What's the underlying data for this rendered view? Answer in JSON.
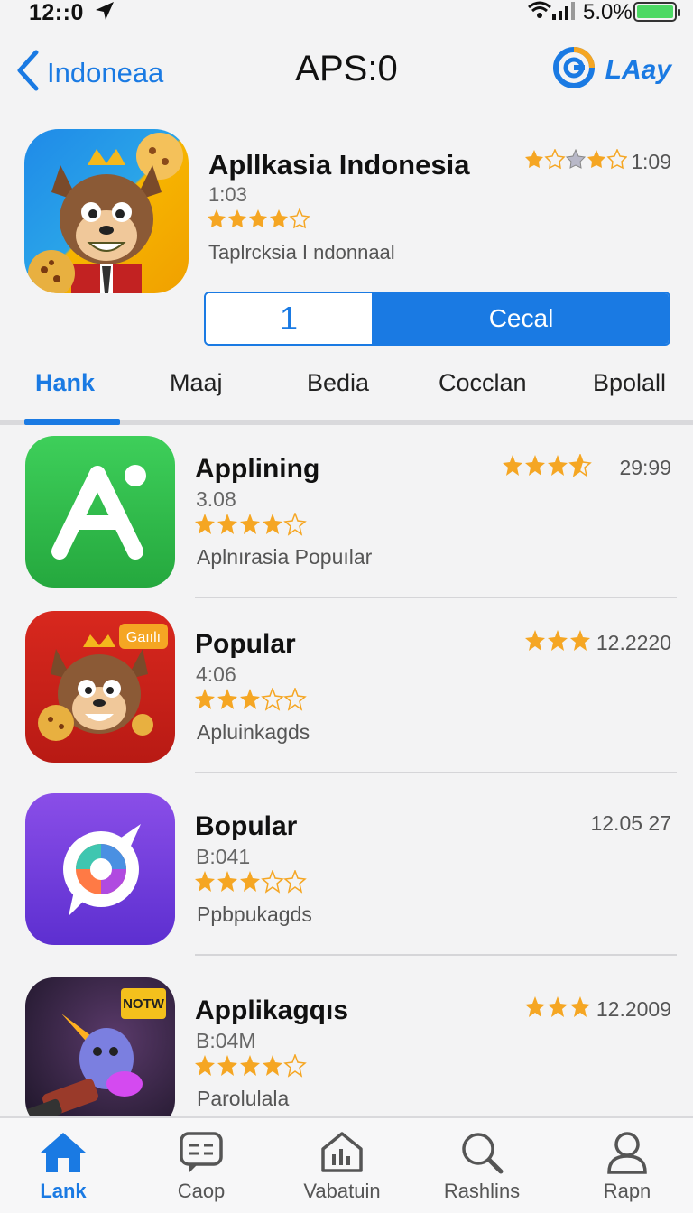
{
  "status_bar": {
    "time": "12::0",
    "battery_text": "5.0%",
    "battery_color": "#4cd964"
  },
  "nav": {
    "back_label": "Indoneaa",
    "title": "APS:0",
    "brand_label": "LAay",
    "accent_color": "#1a7ae3"
  },
  "featured": {
    "title": "Apllkasia Indonesia",
    "subtitle": "1:03",
    "rating_stars": 4,
    "description": "Taplrcksia I ndonnaal",
    "meta": "1:09",
    "meta_stars": 4,
    "segment_left": "1",
    "segment_right": "Cecal"
  },
  "tabs": [
    {
      "label": "Hank",
      "active": true
    },
    {
      "label": "Maaj",
      "active": false
    },
    {
      "label": "Bedia",
      "active": false
    },
    {
      "label": "Cocclan",
      "active": false
    },
    {
      "label": "Bpolall",
      "active": false
    }
  ],
  "apps": [
    {
      "name": "Applining",
      "size": "3.08",
      "stars": 4,
      "description": "Aplnırasia Popuılar",
      "meta": "29:99",
      "meta_stars": 3.5,
      "icon": "letter-a-icon"
    },
    {
      "name": "Popular",
      "size": "4:06",
      "stars": 3,
      "description": "Apluinkagds",
      "meta": "12.2220",
      "meta_stars": 3,
      "icon": "mascot-icon",
      "badge": "Gaıılı"
    },
    {
      "name": "Bopular",
      "size": "B:041",
      "stars": 3,
      "description": "Ppbpukagds",
      "meta": "12.05 27",
      "meta_stars": 0,
      "icon": "compass-icon"
    },
    {
      "name": "Applikagqıs",
      "size": "B:04M",
      "stars": 4,
      "description": "Parolulala",
      "meta": "12.2009",
      "meta_stars": 3,
      "icon": "rocket-icon",
      "badge": "NOTW"
    }
  ],
  "tabbar": [
    {
      "label": "Lank",
      "icon": "home-icon",
      "active": true
    },
    {
      "label": "Caop",
      "icon": "message-icon",
      "active": false
    },
    {
      "label": "Vabatuin",
      "icon": "chart-icon",
      "active": false
    },
    {
      "label": "Rashlins",
      "icon": "search-icon",
      "active": false
    },
    {
      "label": "Rapn",
      "icon": "person-icon",
      "active": false
    }
  ]
}
